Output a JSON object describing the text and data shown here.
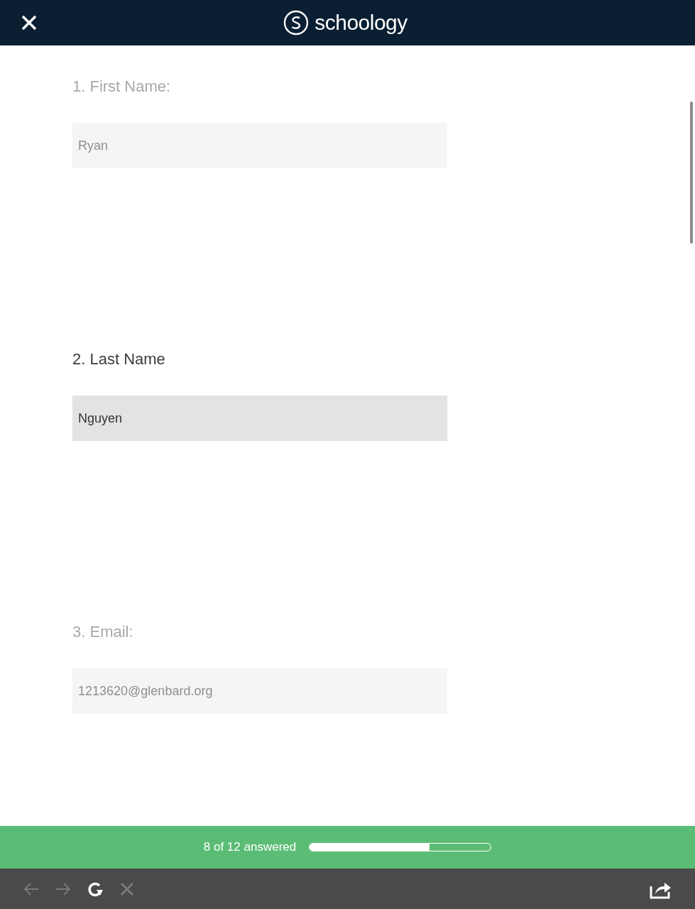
{
  "header": {
    "logo_text": "schoology"
  },
  "questions": [
    {
      "label": "1. First Name:",
      "value": "Ryan",
      "focused": false
    },
    {
      "label": "2. Last Name",
      "value": "Nguyen",
      "focused": true
    },
    {
      "label": "3. Email:",
      "value": "1213620@glenbard.org",
      "focused": false
    }
  ],
  "progress": {
    "text": "8 of 12 answered",
    "level": 0.66
  },
  "toolbar": [
    {
      "kind": "back",
      "disabled": true
    },
    {
      "kind": "forward",
      "disabled": true
    },
    {
      "kind": "reload",
      "disabled": false
    },
    {
      "kind": "stop",
      "disabled": true
    }
  ]
}
